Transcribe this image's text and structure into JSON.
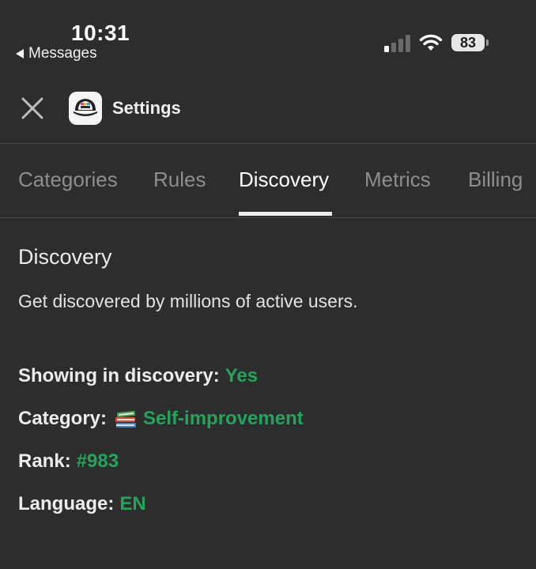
{
  "status": {
    "time": "10:31",
    "back_label": "Messages",
    "battery": "83"
  },
  "header": {
    "title": "Settings"
  },
  "tabs": [
    {
      "label": "Categories"
    },
    {
      "label": "Rules"
    },
    {
      "label": "Discovery"
    },
    {
      "label": "Metrics"
    },
    {
      "label": "Billing"
    }
  ],
  "active_tab": "Discovery",
  "discovery": {
    "title": "Discovery",
    "description": "Get discovered by millions of active users.",
    "showing_label": "Showing in discovery:",
    "showing_value": "Yes",
    "category_label": "Category:",
    "category_icon": "books-icon",
    "category_value": "Self-improvement",
    "rank_label": "Rank:",
    "rank_value": "#983",
    "language_label": "Language:",
    "language_value": "EN"
  },
  "colors": {
    "background": "#2d2d2d",
    "accent_green": "#22a55b",
    "inactive_tab": "#8e8e8e"
  }
}
